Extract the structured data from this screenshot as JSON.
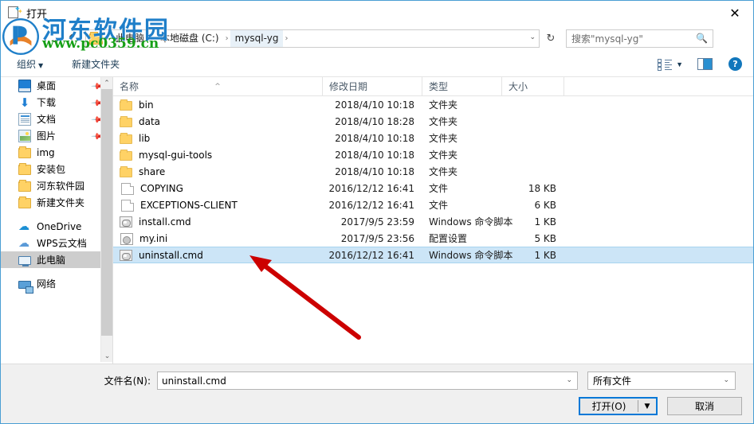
{
  "window": {
    "title": "打开",
    "title_icon": "open-folder-icon",
    "close_label": "✕"
  },
  "nav": {
    "recent_icon": "chevron-down-icon",
    "up_icon": "arrow-up-icon",
    "refresh_icon": "refresh-icon",
    "address_dropdown_icon": "chevron-down-icon",
    "breadcrumbs": [
      "此电脑",
      "本地磁盘 (C:)",
      "mysql-yg"
    ],
    "separator": "›"
  },
  "search": {
    "placeholder": "搜索\"mysql-yg\"",
    "icon": "search-icon"
  },
  "toolbar": {
    "organize_label": "组织",
    "organize_caret": "▼",
    "new_folder_label": "新建文件夹",
    "view_icon": "view-options-icon",
    "view_caret": "▼",
    "preview_pane_icon": "preview-pane-icon",
    "help_label": "?"
  },
  "sidebar": {
    "items": [
      {
        "label": "桌面",
        "icon": "desktop-icon",
        "pinned": true,
        "selected": false
      },
      {
        "label": "下载",
        "icon": "downloads-icon",
        "pinned": true,
        "selected": false
      },
      {
        "label": "文档",
        "icon": "documents-icon",
        "pinned": true,
        "selected": false
      },
      {
        "label": "图片",
        "icon": "pictures-icon",
        "pinned": true,
        "selected": false
      },
      {
        "label": "img",
        "icon": "folder-icon",
        "pinned": false,
        "selected": false
      },
      {
        "label": "安装包",
        "icon": "folder-icon",
        "pinned": false,
        "selected": false
      },
      {
        "label": "河东软件园",
        "icon": "folder-icon",
        "pinned": false,
        "selected": false
      },
      {
        "label": "新建文件夹",
        "icon": "folder-icon",
        "pinned": false,
        "selected": false
      },
      {
        "label": "OneDrive",
        "icon": "onedrive-icon",
        "pinned": false,
        "selected": false
      },
      {
        "label": "WPS云文档",
        "icon": "wps-cloud-icon",
        "pinned": false,
        "selected": false
      },
      {
        "label": "此电脑",
        "icon": "this-pc-icon",
        "pinned": false,
        "selected": true
      },
      {
        "label": "网络",
        "icon": "network-icon",
        "pinned": false,
        "selected": false
      }
    ],
    "scroll_up_icon": "chevron-up-icon",
    "scroll_down_icon": "chevron-down-icon"
  },
  "filelist": {
    "columns": [
      "名称",
      "修改日期",
      "类型",
      "大小"
    ],
    "sort_indicator": "^",
    "rows": [
      {
        "name": "bin",
        "date": "2018/4/10 10:18",
        "type": "文件夹",
        "size": "",
        "icon": "folder-icon",
        "selected": false
      },
      {
        "name": "data",
        "date": "2018/4/10 18:28",
        "type": "文件夹",
        "size": "",
        "icon": "folder-icon",
        "selected": false
      },
      {
        "name": "lib",
        "date": "2018/4/10 10:18",
        "type": "文件夹",
        "size": "",
        "icon": "folder-icon",
        "selected": false
      },
      {
        "name": "mysql-gui-tools",
        "date": "2018/4/10 10:18",
        "type": "文件夹",
        "size": "",
        "icon": "folder-icon",
        "selected": false
      },
      {
        "name": "share",
        "date": "2018/4/10 10:18",
        "type": "文件夹",
        "size": "",
        "icon": "folder-icon",
        "selected": false
      },
      {
        "name": "COPYING",
        "date": "2016/12/12 16:41",
        "type": "文件",
        "size": "18 KB",
        "icon": "file-icon",
        "selected": false
      },
      {
        "name": "EXCEPTIONS-CLIENT",
        "date": "2016/12/12 16:41",
        "type": "文件",
        "size": "6 KB",
        "icon": "file-icon",
        "selected": false
      },
      {
        "name": "install.cmd",
        "date": "2017/9/5 23:59",
        "type": "Windows 命令脚本",
        "size": "1 KB",
        "icon": "cmd-script-icon",
        "selected": false
      },
      {
        "name": "my.ini",
        "date": "2017/9/5 23:56",
        "type": "配置设置",
        "size": "5 KB",
        "icon": "ini-config-icon",
        "selected": false
      },
      {
        "name": "uninstall.cmd",
        "date": "2016/12/12 16:41",
        "type": "Windows 命令脚本",
        "size": "1 KB",
        "icon": "cmd-script-icon",
        "selected": true
      }
    ]
  },
  "bottom": {
    "filename_label": "文件名(N):",
    "filename_value": "uninstall.cmd",
    "filename_caret": "⌄",
    "filetype_value": "所有文件",
    "filetype_caret": "⌄",
    "open_label": "打开(O)",
    "open_split_caret": "▼",
    "cancel_label": "取消"
  },
  "watermark": {
    "site_name": "河东软件园",
    "site_url": "www.pc0359.cn"
  },
  "colors": {
    "accent": "#0078d7",
    "selection": "#cce5f7",
    "watermark_blue": "#1f7fc9",
    "watermark_green": "#17a017",
    "annotation_red": "#cc0000",
    "folder_yellow": "#ffd265"
  },
  "annotation": {
    "arrow": "red-pointer-arrow"
  }
}
